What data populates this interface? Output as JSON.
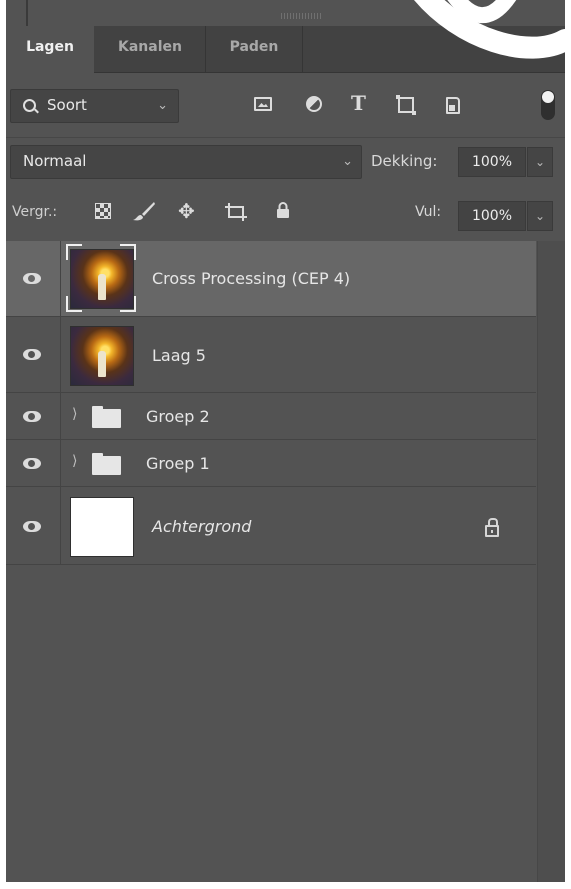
{
  "tabs": [
    {
      "label": "Lagen",
      "active": true
    },
    {
      "label": "Kanalen",
      "active": false
    },
    {
      "label": "Paden",
      "active": false
    }
  ],
  "filter": {
    "kind_label": "Soort",
    "icons": [
      "pixel-layer-filter-icon",
      "adjustment-layer-filter-icon",
      "type-layer-filter-icon",
      "shape-layer-filter-icon",
      "smart-object-filter-icon"
    ]
  },
  "blend": {
    "mode": "Normaal",
    "opacity_label": "Dekking:",
    "opacity_value": "100%"
  },
  "locks": {
    "label": "Vergr.:",
    "icons": [
      "lock-transparent-pixels-icon",
      "lock-image-pixels-icon",
      "lock-position-icon",
      "lock-artboard-icon",
      "lock-all-icon"
    ],
    "fill_label": "Vul:",
    "fill_value": "100%"
  },
  "layers": [
    {
      "name": "Cross Processing (CEP 4)",
      "type": "smart-photo",
      "selected": true,
      "visible": true
    },
    {
      "name": "Laag 5",
      "type": "photo",
      "selected": false,
      "visible": true
    },
    {
      "name": "Groep 2",
      "type": "group",
      "selected": false,
      "visible": true,
      "collapsed": true
    },
    {
      "name": "Groep 1",
      "type": "group",
      "selected": false,
      "visible": true,
      "collapsed": true
    },
    {
      "name": "Achtergrond",
      "type": "background",
      "selected": false,
      "visible": true,
      "locked": true
    }
  ],
  "colors": {
    "panel_bg": "#535353",
    "tabbar_bg": "#424242",
    "selected_row": "#676767",
    "text": "#e6e6e6"
  }
}
